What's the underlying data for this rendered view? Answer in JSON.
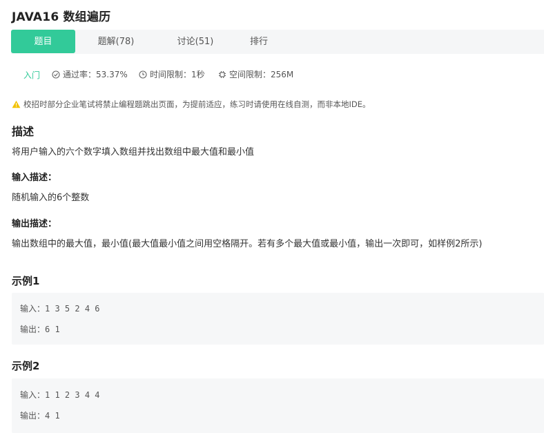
{
  "problem": {
    "title": "JAVA16  数组遍历"
  },
  "tabs": [
    {
      "label": "题目",
      "active": true
    },
    {
      "label": "题解(78)",
      "active": false
    },
    {
      "label": "讨论(51)",
      "active": false
    },
    {
      "label": "排行",
      "active": false
    }
  ],
  "meta": {
    "level": "入门",
    "pass_rate": "通过率：53.37%",
    "time_limit": "时间限制：1秒",
    "memory_limit": "空间限制：256M"
  },
  "notice": "校招时部分企业笔试将禁止编程题跳出页面，为提前适应，练习时请使用在线自测，而非本地IDE。",
  "description": {
    "heading": "描述",
    "text": "将用户输入的六个数字填入数组并找出数组中最大值和最小值"
  },
  "input_desc": {
    "heading": "输入描述：",
    "text": "随机输入的6个整数"
  },
  "output_desc": {
    "heading": "输出描述：",
    "text": "输出数组中的最大值，最小值(最大值最小值之间用空格隔开。若有多个最大值或最小值，输出一次即可，如样例2所示)"
  },
  "examples": [
    {
      "heading": "示例1",
      "input_label": "输入：",
      "input": "1 3 5 2 4 6",
      "output_label": "输出：",
      "output": "6 1"
    },
    {
      "heading": "示例2",
      "input_label": "输入：",
      "input": "1 1 2 3 4 4",
      "output_label": "输出：",
      "output": "4 1"
    }
  ],
  "colors": {
    "accent": "#32ca99",
    "warning": "#f2c200",
    "example_bg": "#f6f7f8"
  },
  "icons": [
    "check-circle-icon",
    "clock-icon",
    "memory-chip-icon",
    "warning-icon"
  ]
}
